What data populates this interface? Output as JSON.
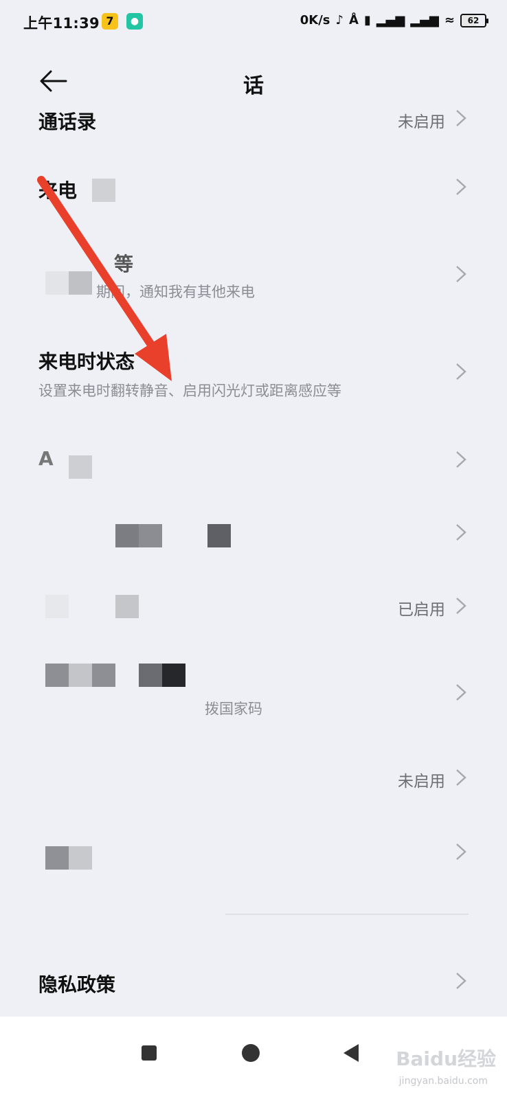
{
  "status_bar": {
    "time": "上午11:39",
    "app_icon_1": "7",
    "app_icon_2": "bike-icon",
    "network_speed": "0K/s",
    "battery": "62"
  },
  "header": {
    "back_icon": "arrow-left-icon",
    "title": "话"
  },
  "items": [
    {
      "title": "通话录",
      "value": "未启用"
    },
    {
      "title": "来电"
    },
    {
      "title": "等",
      "subtitle": "期间，通知我有其他来电"
    },
    {
      "title": "来电时状态",
      "subtitle": "设置来电时翻转静音、启用闪光灯或距离感应等"
    },
    {
      "title": "A"
    },
    {
      "title": ""
    },
    {
      "title": "",
      "value": "已启用"
    },
    {
      "title": "",
      "subtitle": "拨国家码"
    },
    {
      "title": "",
      "value": "未启用"
    },
    {
      "title": ""
    },
    {
      "title": "隐私政策"
    }
  ],
  "watermark": {
    "brand": "Baidu经验",
    "url": "jingyan.baidu.com"
  }
}
